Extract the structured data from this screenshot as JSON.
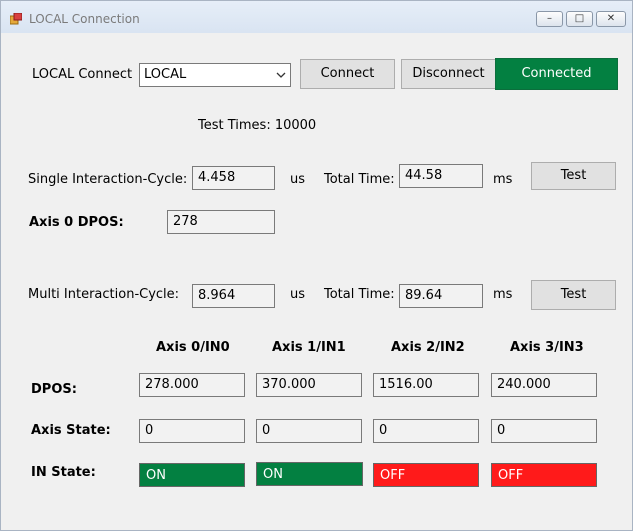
{
  "window": {
    "title": "LOCAL Connection",
    "controls": {
      "minimize": "–",
      "maximize": "□",
      "close": "✕"
    }
  },
  "connection": {
    "label": "LOCAL Connect",
    "combo_value": "LOCAL",
    "connect_label": "Connect",
    "disconnect_label": "Disconnect",
    "status_label": "Connected",
    "status_color": "#038041"
  },
  "test_times": "Test Times: 10000",
  "single": {
    "label": "Single Interaction-Cycle:",
    "cycle_value": "4.458",
    "cycle_unit": "us",
    "total_label": "Total Time:",
    "total_value": "44.58",
    "total_unit": "ms",
    "test_label": "Test",
    "axis_label": "Axis 0 DPOS:",
    "axis_value": "278"
  },
  "multi": {
    "label": "Multi Interaction-Cycle:",
    "cycle_value": "8.964",
    "cycle_unit": "us",
    "total_label": "Total Time:",
    "total_value": "89.64",
    "total_unit": "ms",
    "test_label": "Test"
  },
  "axes": {
    "headers": [
      "Axis 0/IN0",
      "Axis 1/IN1",
      "Axis 2/IN2",
      "Axis 3/IN3"
    ],
    "dpos_label": "DPOS:",
    "dpos": [
      "278.000",
      "370.000",
      "1516.00",
      "240.000"
    ],
    "state_label": "Axis State:",
    "state": [
      "0",
      "0",
      "0",
      "0"
    ],
    "in_label": "IN State:",
    "in_state": [
      "ON",
      "ON",
      "OFF",
      "OFF"
    ],
    "on_color": "#038041",
    "off_color": "#ff1a1a"
  }
}
